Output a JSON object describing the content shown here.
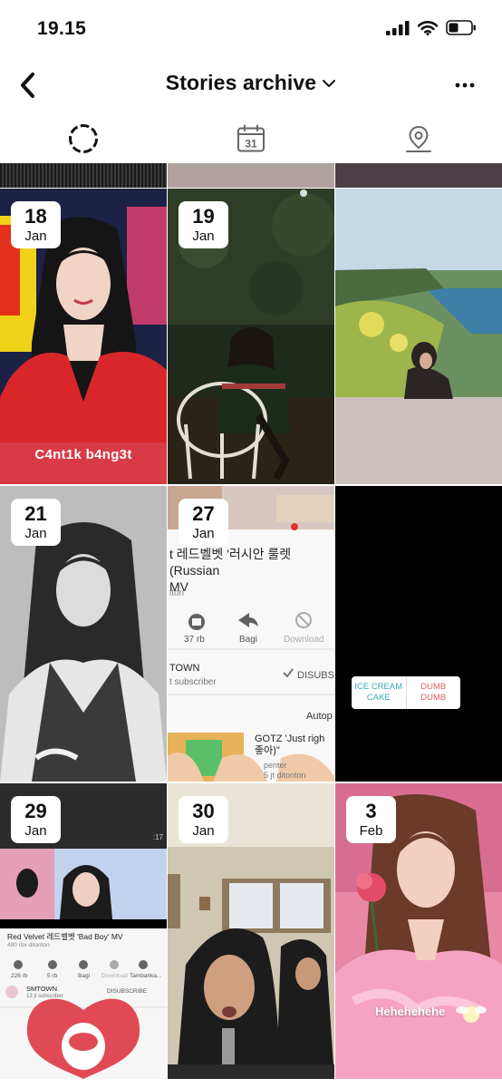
{
  "status_bar": {
    "time": "19.15"
  },
  "header": {
    "title": "Stories archive"
  },
  "tabs": [
    {
      "name": "stories",
      "icon": "stories-circle-icon"
    },
    {
      "name": "calendar",
      "icon": "calendar-icon",
      "calendar_day": "31"
    },
    {
      "name": "map",
      "icon": "location-pin-icon"
    }
  ],
  "stories": [
    {
      "day": "18",
      "month": "Jan",
      "caption": "C4nt1k b4ng3t"
    },
    {
      "day": "19",
      "month": "Jan"
    },
    {
      "day": "",
      "month": ""
    },
    {
      "day": "21",
      "month": "Jan"
    },
    {
      "day": "27",
      "month": "Jan",
      "screenshot": {
        "title": "t 레드벨벳 '러시안 룰렛 (Russian\nMV",
        "views": "iton",
        "likes": "37 rb",
        "share": "Bagi",
        "download": "Download",
        "channel": "TOWN",
        "subscribers": "t subscriber",
        "subscribe": "DISUBS",
        "autoplay": "Autop",
        "next_title": "GOTZ 'Just righ\n좋아)\"",
        "next_sub": "penter\n5 jt ditonton"
      }
    },
    {
      "day": "",
      "month": "",
      "chips": [
        "ICE CREAM\nCAKE",
        "DUMB\nDUMB"
      ]
    },
    {
      "day": "29",
      "month": "Jan",
      "screenshot": {
        "title": "Red Velvet 레드벨벳 'Bad Boy' MV",
        "views": "490 rbx ditonton",
        "likes": "226 rb",
        "dislikes": "5 rb",
        "share": "Bagi",
        "download": "Download",
        "add": "Tambahka...",
        "channel": "SMTOWN",
        "subscribers": "13 jt subscriber",
        "subscribe": "DISUBSCRIBE",
        "video_time": ":17"
      }
    },
    {
      "day": "30",
      "month": "Jan"
    },
    {
      "day": "3",
      "month": "Feb",
      "caption": "Hehehehehe"
    }
  ]
}
